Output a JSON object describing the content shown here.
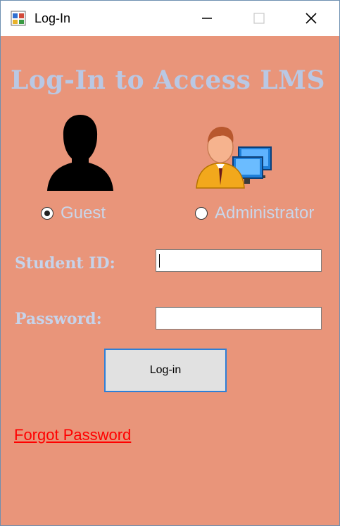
{
  "window": {
    "title": "Log-In"
  },
  "titlebar_buttons": {
    "minimize_icon": "minimize-icon",
    "maximize_icon": "maximize-icon",
    "close_icon": "close-icon"
  },
  "form": {
    "heading": "Log-In to Access LMS",
    "roles": [
      {
        "label": "Guest",
        "selected": true
      },
      {
        "label": "Administrator",
        "selected": false
      }
    ],
    "student_id_label": "Student ID:",
    "student_id_value": "",
    "password_label": "Password:",
    "password_value": "",
    "login_button": "Log-in",
    "forgot_link": "Forgot Password"
  },
  "colors": {
    "background": "#e9957a",
    "heading": "#b9c8e4",
    "link": "#ff0000",
    "button_border": "#2e7fd6"
  }
}
